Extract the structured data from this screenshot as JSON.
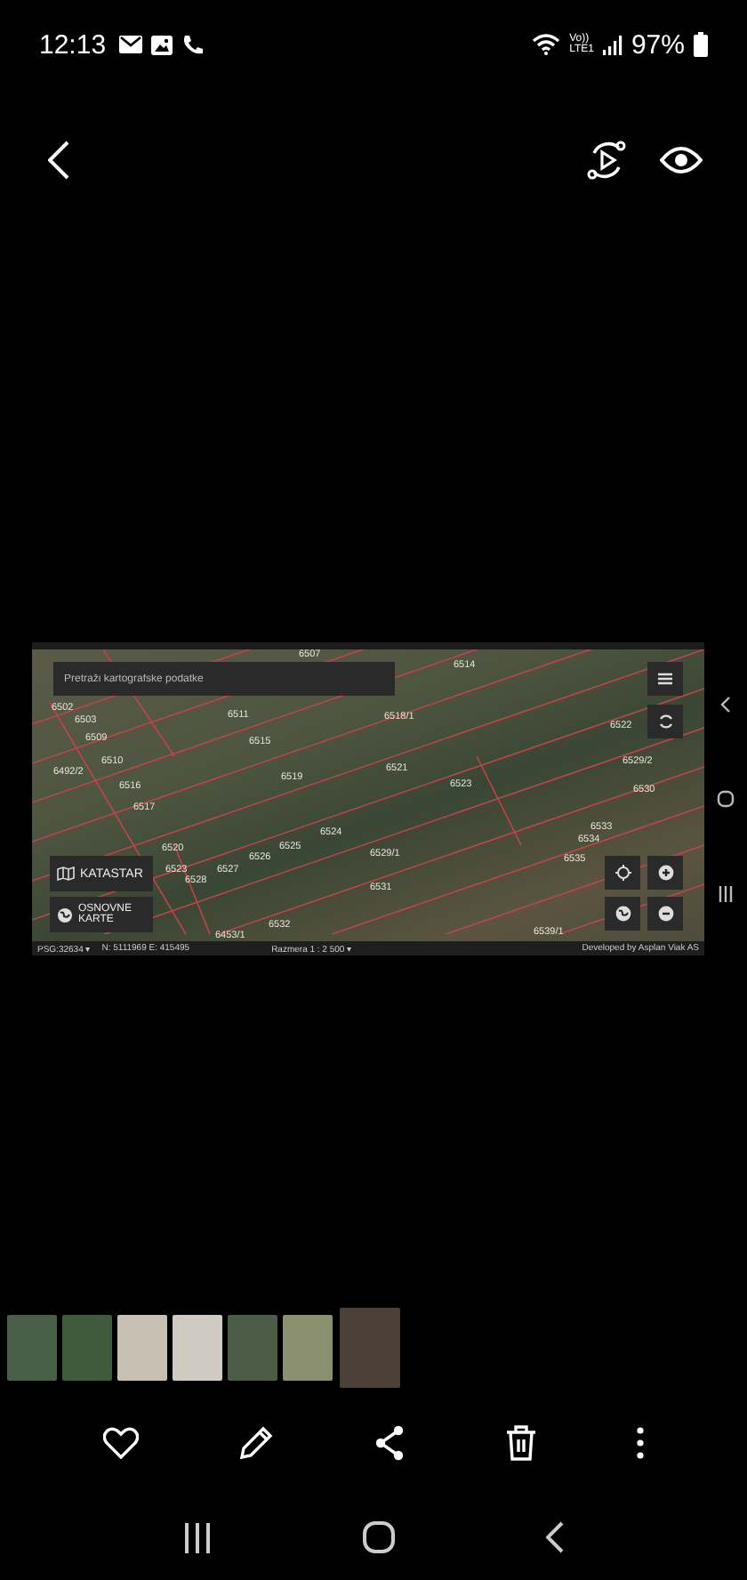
{
  "status_bar": {
    "time": "12:13",
    "network_top": "Vo))",
    "network_bottom": "LTE1",
    "battery": "97%"
  },
  "photo": {
    "search": {
      "placeholder": "Pretraži kartografske podatke"
    },
    "parcel_labels": [
      "6507",
      "6514",
      "6502",
      "6503",
      "6509",
      "6510",
      "6516",
      "6492/2",
      "6517",
      "6511",
      "6515",
      "6519",
      "6518/1",
      "6521",
      "6523",
      "6522",
      "6529/2",
      "6530",
      "6520",
      "6523",
      "6528",
      "6527",
      "6526",
      "6525",
      "6524",
      "6529/1",
      "6531",
      "6533",
      "6534",
      "6535",
      "6532",
      "6453/1",
      "6539/1"
    ],
    "layer_buttons": [
      {
        "kind": "cadastre",
        "label": "KATASTAR"
      },
      {
        "kind": "basemap",
        "label": "OSNOVNE KARTE"
      }
    ],
    "footer": {
      "projection": "PSG:32634 ▾",
      "coordinates": "N: 5111969 E: 415495",
      "scale": "Razmera 1 : 2 500 ▾",
      "credit": "Developed by Asplan Viak AS"
    }
  },
  "thumbnails": [
    {
      "selected": false
    },
    {
      "selected": false
    },
    {
      "selected": false
    },
    {
      "selected": false
    },
    {
      "selected": false
    },
    {
      "selected": false
    },
    {
      "selected": true
    }
  ]
}
